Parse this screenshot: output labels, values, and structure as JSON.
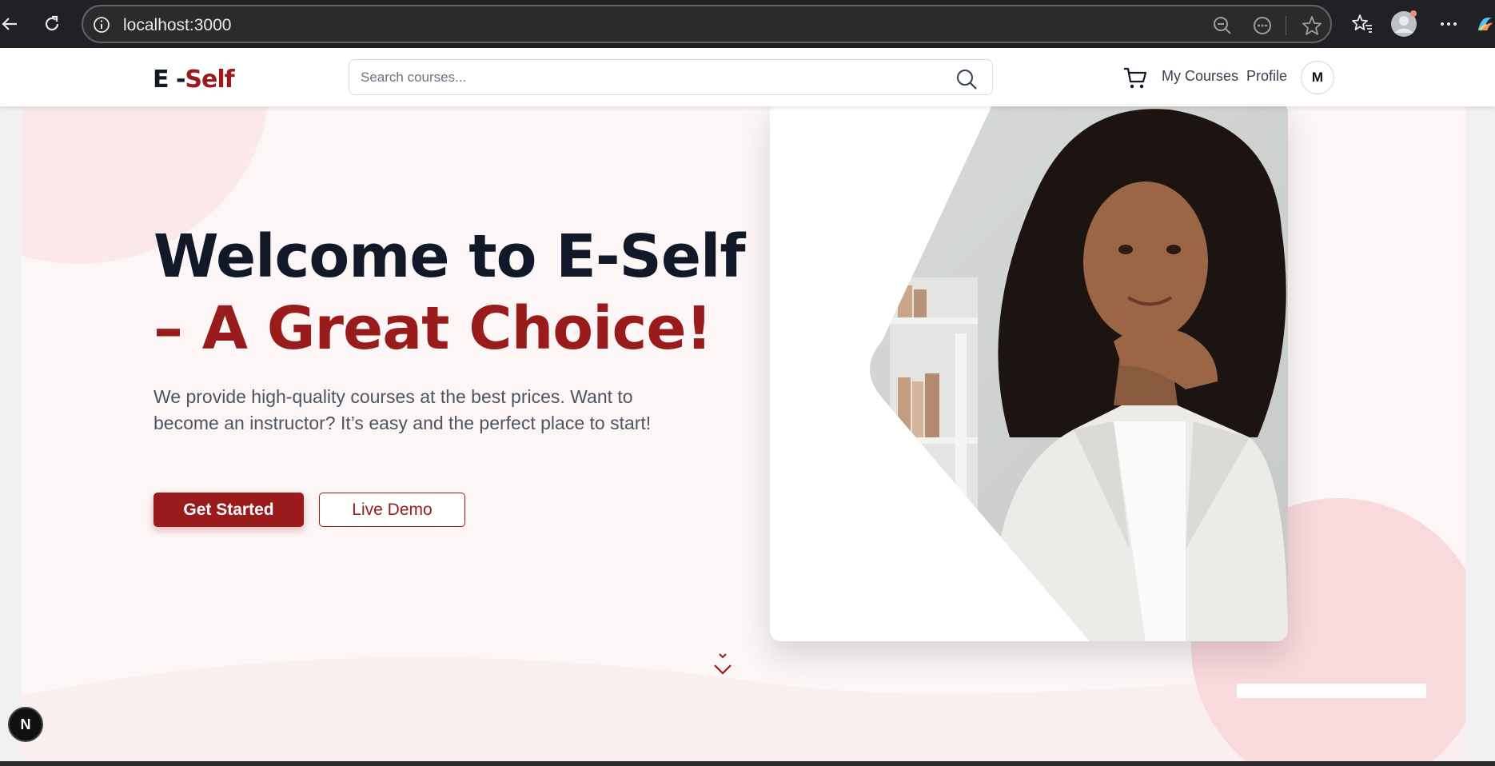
{
  "browser": {
    "url": "localhost:3000"
  },
  "header": {
    "logo_prefix": "E -",
    "logo_suffix": "Self",
    "search_placeholder": "Search courses...",
    "nav": {
      "my_courses": "My Courses",
      "profile": "Profile"
    },
    "avatar_initial": "M"
  },
  "hero": {
    "title_line1": "Welcome to E-Self",
    "title_line2": "– A Great Choice!",
    "description": "We provide high-quality courses at the best prices. Want to become an instructor? It’s easy and the perfect place to start!",
    "primary_button": "Get Started",
    "secondary_button": "Live Demo"
  },
  "dev_badge": "N",
  "colors": {
    "brand": "#991b1b",
    "heading": "#111827",
    "hero_bg": "#fdf6f6",
    "accent_blob": "#f8d9dc"
  },
  "icons": [
    "back-icon",
    "reload-icon",
    "info-icon",
    "zoom-out-icon",
    "more-tools-icon",
    "star-icon",
    "favorites-icon",
    "profile-icon",
    "menu-dots-icon",
    "copilot-icon",
    "search-icon",
    "cart-icon",
    "chevron-down-icon"
  ]
}
